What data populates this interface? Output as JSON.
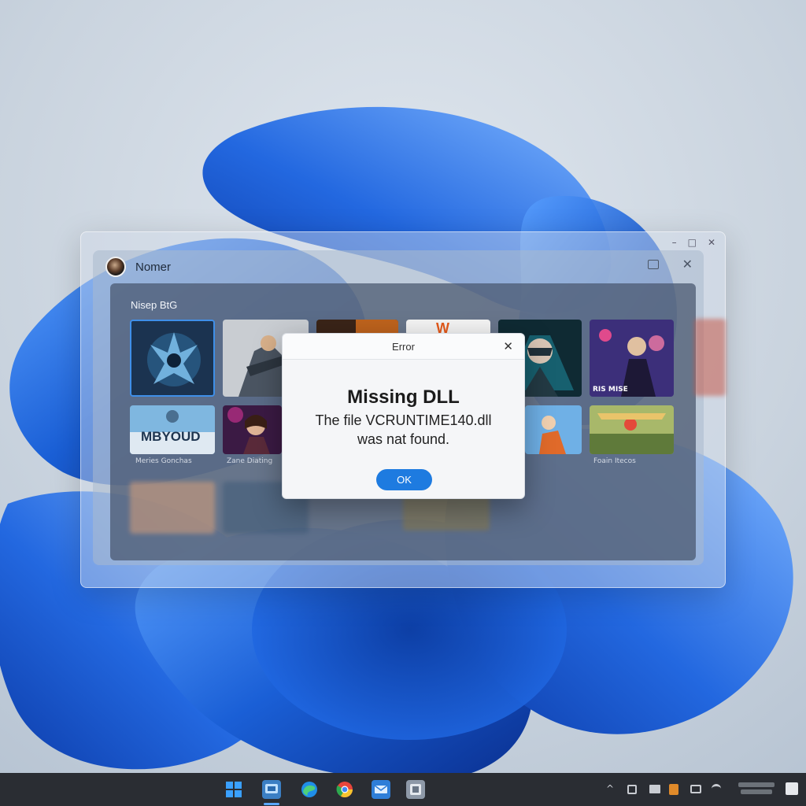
{
  "launcher": {
    "app_title": "Nomer",
    "library_title": "Nisep BtG"
  },
  "tiles": [
    {
      "label": ""
    },
    {
      "label": ""
    },
    {
      "label": ""
    },
    {
      "label": ""
    },
    {
      "label": ""
    },
    {
      "label": ""
    },
    {
      "label": "Meries Gonchas"
    },
    {
      "label": "Zane Diating"
    },
    {
      "label": ""
    },
    {
      "label": "Foain Itecos"
    }
  ],
  "tile_art_text": {
    "w_logo": "W",
    "rise": "RIS MISE",
    "beyond": "MBYOUD"
  },
  "dialog": {
    "title": "Error",
    "close_glyph": "✕",
    "heading": "Missing DLL",
    "message_line1": "The file VCRUNTIME140.dll",
    "message_line2": "was nat found.",
    "ok_label": "OK"
  },
  "window_controls": {
    "minimize": "–",
    "maximize": "□",
    "close": "✕"
  },
  "taskbar": {
    "icons": [
      "windows-start-icon",
      "app-launcher-icon",
      "edge-icon",
      "chrome-icon",
      "mail-icon",
      "settings-app-icon"
    ],
    "tray_chevron": "^",
    "clock_time": "",
    "clock_date": ""
  },
  "colors": {
    "accent": "#1e7be0",
    "wallpaper_blue": "#1a5fd6",
    "taskbar": "#2a2d33"
  }
}
